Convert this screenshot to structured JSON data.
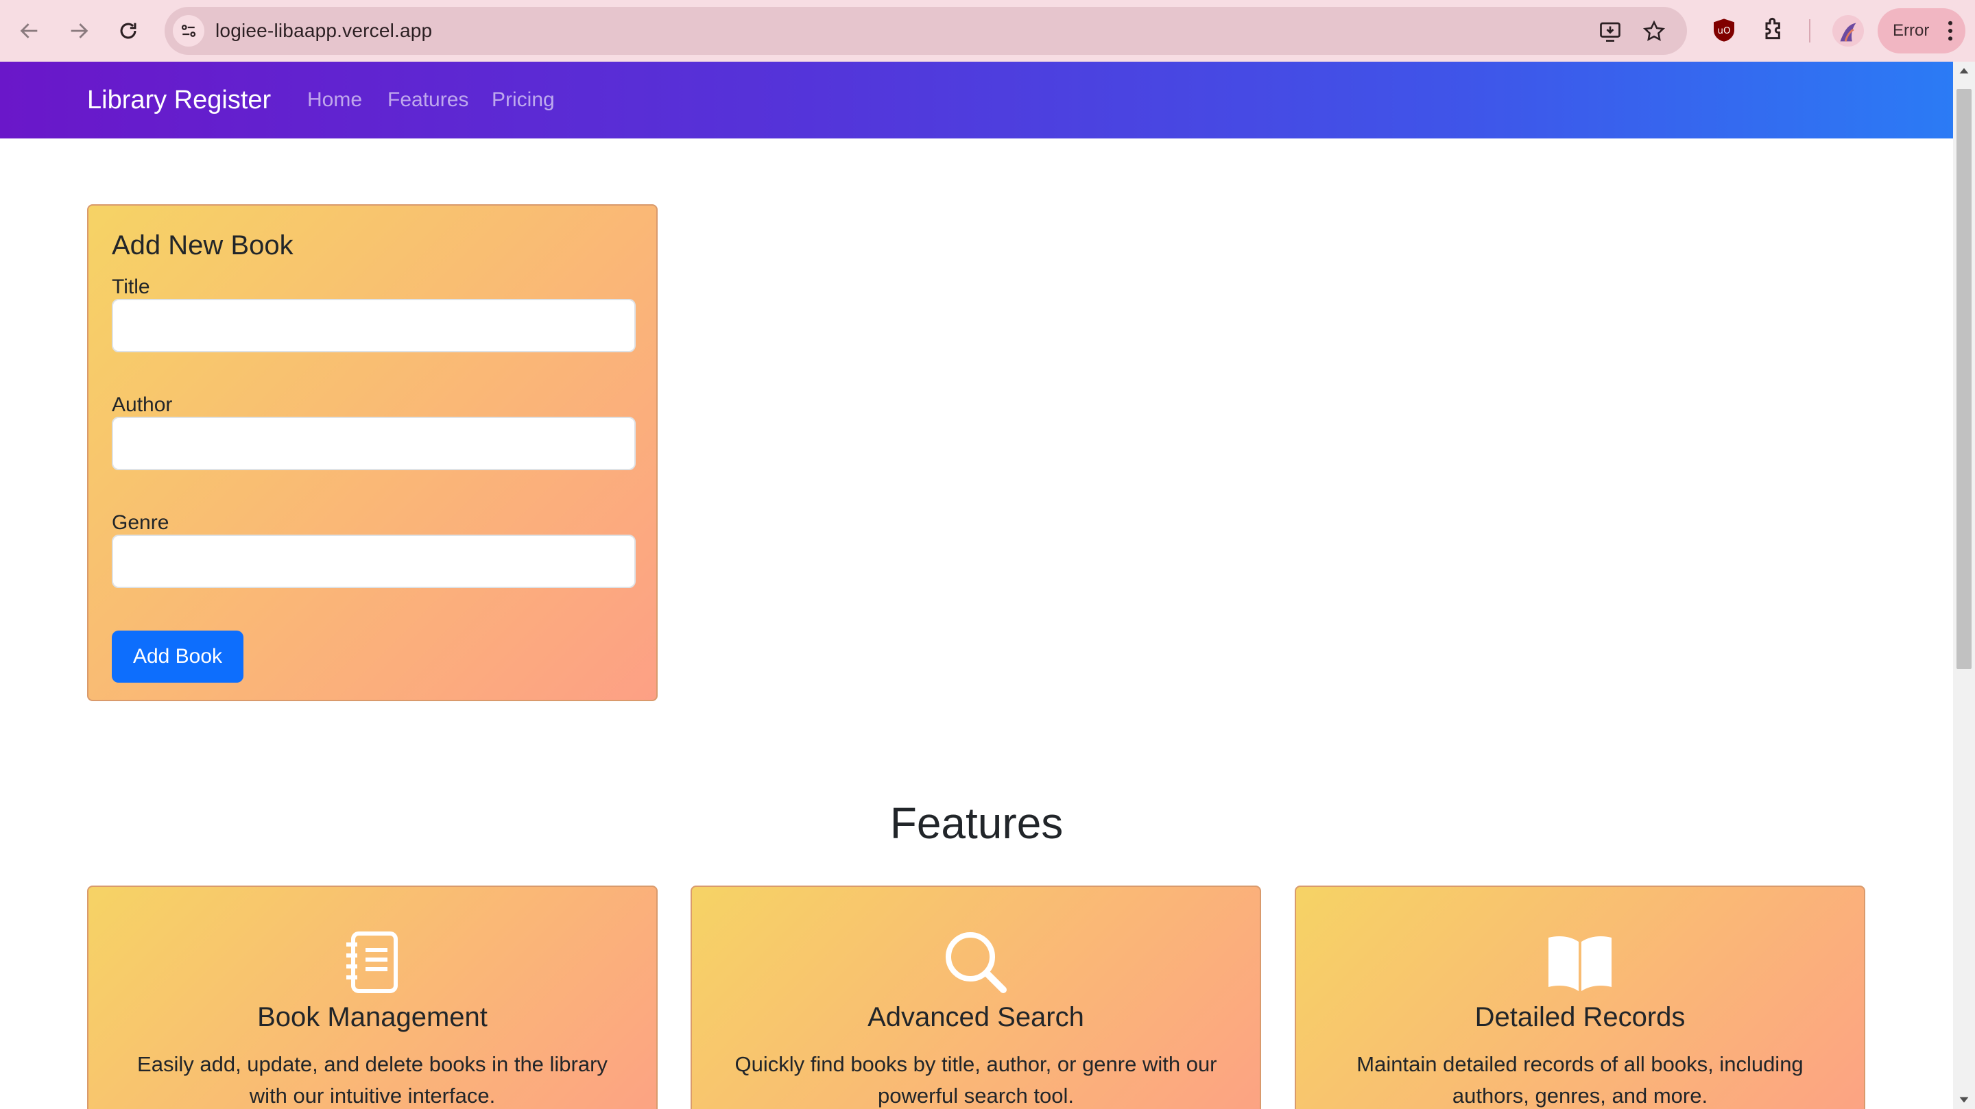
{
  "browser": {
    "url": "logiee-libaapp.vercel.app",
    "profile_status": "Error",
    "icons": [
      "back-icon",
      "forward-icon",
      "reload-icon",
      "site-settings-icon",
      "install-app-icon",
      "bookmark-star-icon",
      "ublock-icon",
      "extensions-icon",
      "profile-avatar",
      "more-menu-icon"
    ]
  },
  "navbar": {
    "brand": "Library Register",
    "links": [
      "Home",
      "Features",
      "Pricing"
    ]
  },
  "form": {
    "title": "Add New Book",
    "fields": [
      {
        "label": "Title",
        "value": "",
        "placeholder": ""
      },
      {
        "label": "Author",
        "value": "",
        "placeholder": ""
      },
      {
        "label": "Genre",
        "value": "",
        "placeholder": ""
      }
    ],
    "submit_label": "Add Book"
  },
  "features": {
    "heading": "Features",
    "cards": [
      {
        "icon": "journal-icon",
        "title": "Book Management",
        "description": "Easily add, update, and delete books in the library with our intuitive interface."
      },
      {
        "icon": "search-icon",
        "title": "Advanced Search",
        "description": "Quickly find books by title, author, or genre with our powerful search tool."
      },
      {
        "icon": "book-icon",
        "title": "Detailed Records",
        "description": "Maintain detailed records of all books, including authors, genres, and more."
      }
    ]
  },
  "colors": {
    "navbar_gradient": [
      "#6a17c9",
      "#2b7bf5"
    ],
    "card_gradient": [
      "#f6d365",
      "#fda085"
    ],
    "primary_button": "#0d6efd"
  }
}
